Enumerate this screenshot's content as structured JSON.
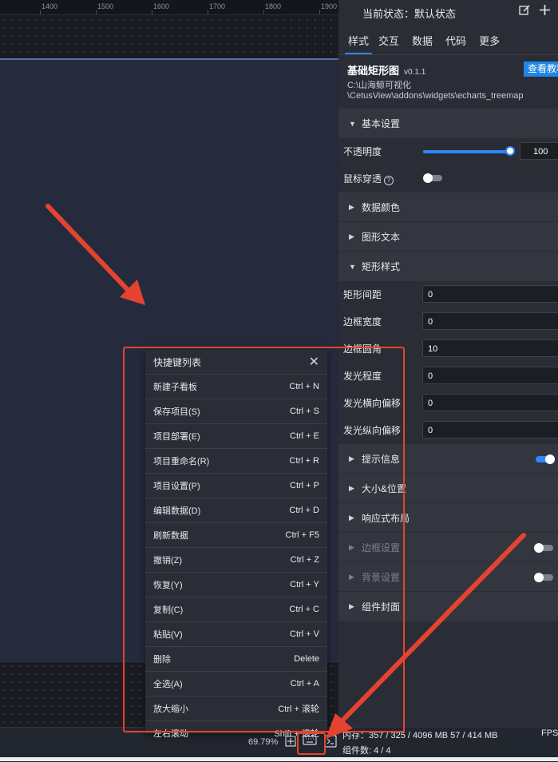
{
  "ruler": {
    "ticks": [
      "1400",
      "1500",
      "1600",
      "1700",
      "1800",
      "1900"
    ]
  },
  "shortcut_panel": {
    "title": "快捷键列表",
    "items": [
      {
        "label": "新建子看板",
        "key": "Ctrl + N"
      },
      {
        "label": "保存项目(S)",
        "key": "Ctrl + S"
      },
      {
        "label": "项目部署(E)",
        "key": "Ctrl + E"
      },
      {
        "label": "项目重命名(R)",
        "key": "Ctrl + R"
      },
      {
        "label": "项目设置(P)",
        "key": "Ctrl + P"
      },
      {
        "label": "编辑数据(D)",
        "key": "Ctrl + D"
      },
      {
        "label": "刷新数据",
        "key": "Ctrl + F5"
      },
      {
        "label": "撤销(Z)",
        "key": "Ctrl + Z"
      },
      {
        "label": "恢复(Y)",
        "key": "Ctrl + Y"
      },
      {
        "label": "复制(C)",
        "key": "Ctrl + C"
      },
      {
        "label": "粘贴(V)",
        "key": "Ctrl + V"
      },
      {
        "label": "删除",
        "key": "Delete"
      },
      {
        "label": "全选(A)",
        "key": "Ctrl + A"
      },
      {
        "label": "放大缩小",
        "key": "Ctrl + 滚轮"
      },
      {
        "label": "左右滚动",
        "key": "Shift + 滚轮"
      }
    ]
  },
  "status_bar": {
    "zoom": "69.79%",
    "memory": "内存：357 / 325 / 4096 MB  57 / 414 MB",
    "fps": "FPS",
    "component_count": "组件数: 4 / 4"
  },
  "right_panel": {
    "current_state": "当前状态：默认状态",
    "tabs": [
      "样式",
      "交互",
      "数据",
      "代码",
      "更多"
    ],
    "widget": {
      "name": "基础矩形图",
      "version": "v0.1.1",
      "path_line1": "C:\\山海鲸可视化",
      "path_line2": "\\CetusView\\addons\\widgets\\echarts_treemap",
      "tutorial_button": "查看教程"
    },
    "sections": {
      "basic": "基本设置",
      "data_color": "数据颜色",
      "graphic_text": "图形文本",
      "rect_style": "矩形样式",
      "tooltip": "提示信息",
      "size_position": "大小&位置",
      "responsive": "响应式布局",
      "border": "边框设置",
      "background": "背景设置",
      "cover": "组件封面"
    },
    "basic": {
      "opacity_label": "不透明度",
      "opacity_value": "100",
      "opacity_level": 1.0,
      "mouse_through_label": "鼠标穿透"
    },
    "rect_style": {
      "spacing_label": "矩形间距",
      "spacing_value": "0",
      "border_width_label": "边框宽度",
      "border_width_value": "0",
      "radius_label": "边框圆角",
      "radius_value": "10",
      "glow_label": "发光程度",
      "glow_value": "0",
      "glow_x_label": "发光横向偏移",
      "glow_x_value": "0",
      "glow_y_label": "发光纵向偏移",
      "glow_y_value": "0"
    },
    "toggles": {
      "mouse_through": false,
      "tooltip": true,
      "border": false,
      "background": false
    }
  },
  "colors": {
    "accent": "#2f86ff",
    "annotation": "#e5432f",
    "panel_bg": "#2a2d35",
    "canvas_bg": "#252b3d"
  }
}
